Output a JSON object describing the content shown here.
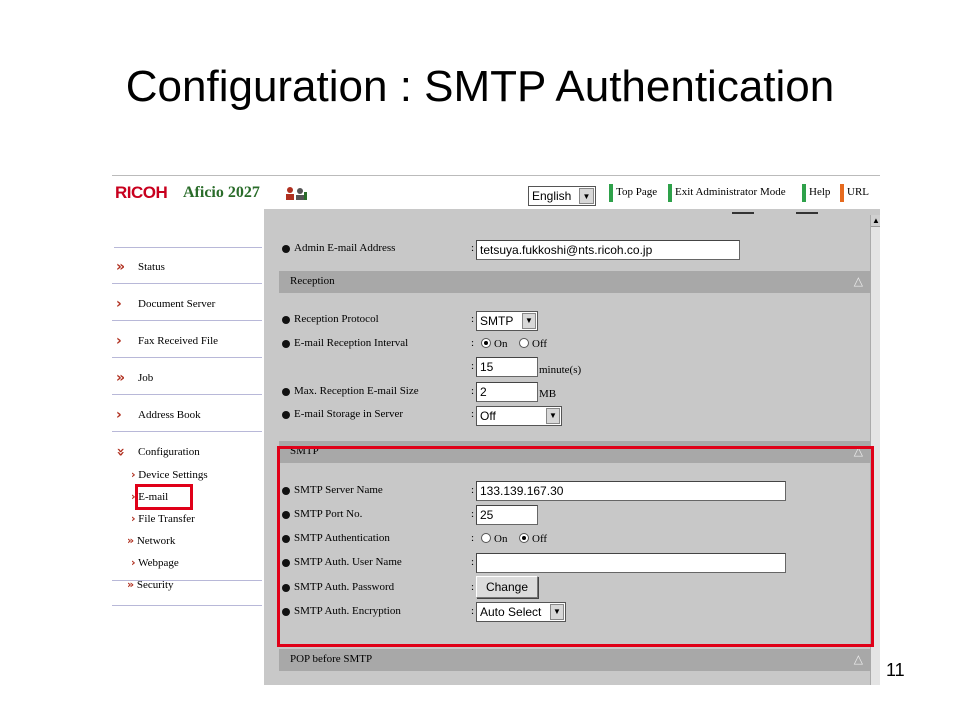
{
  "slide": {
    "title": "Configuration : SMTP Authentication",
    "page_number": "11"
  },
  "header": {
    "logo": "RICOH",
    "model": "Aficio 2027",
    "language": "English",
    "links": [
      "Top Page",
      "Exit Administrator Mode",
      "Help",
      "URL"
    ]
  },
  "nav": {
    "items": [
      {
        "label": "Status",
        "icon": "double-chevron-icon"
      },
      {
        "label": "Document Server",
        "icon": "chevron-icon"
      },
      {
        "label": "Fax Received File",
        "icon": "chevron-icon"
      },
      {
        "label": "Job",
        "icon": "double-chevron-icon"
      },
      {
        "label": "Address Book",
        "icon": "chevron-icon"
      },
      {
        "label": "Configuration",
        "icon": "double-chevron-down-icon"
      }
    ],
    "sub_items": [
      "Device Settings",
      "E-mail",
      "File Transfer",
      "Network",
      "Webpage",
      "Security"
    ]
  },
  "form": {
    "admin_email": {
      "label": "Admin E-mail Address",
      "value": "tetsuya.fukkoshi@nts.ricoh.co.jp"
    },
    "reception": {
      "title": "Reception",
      "protocol": {
        "label": "Reception Protocol",
        "value": "SMTP"
      },
      "interval": {
        "label": "E-mail Reception Interval",
        "on": "On",
        "off": "Off",
        "selected": "On",
        "value": "15",
        "unit": "minute(s)"
      },
      "max_size": {
        "label": "Max. Reception E-mail Size",
        "value": "2",
        "unit": "MB"
      },
      "storage": {
        "label": "E-mail Storage in Server",
        "value": "Off"
      }
    },
    "smtp": {
      "title": "SMTP",
      "server_name": {
        "label": "SMTP Server Name",
        "value": "133.139.167.30"
      },
      "port": {
        "label": "SMTP Port No.",
        "value": "25"
      },
      "auth": {
        "label": "SMTP Authentication",
        "on": "On",
        "off": "Off",
        "selected": "Off"
      },
      "user_name": {
        "label": "SMTP Auth. User Name",
        "value": ""
      },
      "password": {
        "label": "SMTP Auth. Password",
        "button": "Change"
      },
      "encryption": {
        "label": "SMTP Auth. Encryption",
        "value": "Auto Select"
      }
    },
    "pop_before_smtp": {
      "title": "POP before SMTP"
    }
  },
  "colors": {
    "highlight": "#e00018",
    "panel": "#c8c8c8",
    "section_bar": "#a8a8a8",
    "brand_red": "#c8001e"
  }
}
